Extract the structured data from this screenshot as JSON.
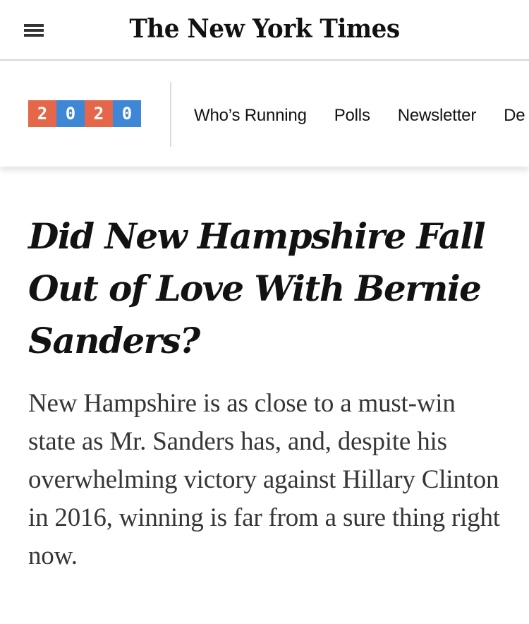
{
  "masthead": {
    "logo_text": "The New York Times",
    "menu_icon": "hamburger-menu-icon"
  },
  "election_bar": {
    "badge_digits": [
      "2",
      "0",
      "2",
      "0"
    ],
    "badge_colors": [
      "#e4674a",
      "#3e86d6",
      "#e4674a",
      "#3e86d6"
    ],
    "nav_items": [
      "Who’s Running",
      "Polls",
      "Newsletter",
      "De"
    ]
  },
  "article": {
    "headline": "Did New Hampshire Fall Out of Love With Bernie Sanders?",
    "summary": "New Hampshire is as close to a must-win state as Mr. Sanders has, and, despite his overwhelming victory against Hillary Clinton in 2016, winning is far from a sure thing right now."
  }
}
